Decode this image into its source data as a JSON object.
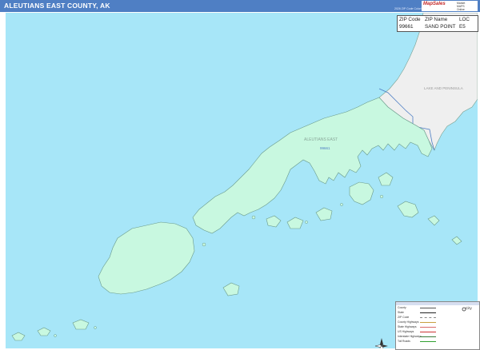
{
  "header": {
    "title": "ALEUTIANS EAST COUNTY, AK",
    "edition": "2026 ZIP Code Color/Cast Edition",
    "brand_logo": "MapSales",
    "brand_lines": [
      "Market",
      "MAPS",
      "Online"
    ]
  },
  "zip_table": {
    "columns": [
      "ZIP Code",
      "ZIP Name",
      "LOC"
    ],
    "rows": [
      {
        "zip": "99661",
        "name": "SAND POINT",
        "loc": "E5"
      }
    ]
  },
  "map": {
    "labels": {
      "county": "ALEUTIANS EAST",
      "zip": "99661",
      "neighbor": "LAKE AND PENINSULA"
    },
    "colors": {
      "water": "#a7e6f8",
      "land_zip": "#c8f8e0",
      "land_neighbor": "#efefef",
      "border": "#4f7fc4",
      "coast": "#6a9a8a"
    }
  },
  "legend": {
    "items": [
      {
        "label": "County",
        "desc": "",
        "color": "#555555"
      },
      {
        "label": "State",
        "desc": "",
        "color": "#222222"
      },
      {
        "label": "ZIP Code",
        "desc": "",
        "color": "#888888"
      },
      {
        "label": "County Highways",
        "desc": "",
        "color": "#c8a040"
      },
      {
        "label": "State Highways",
        "desc": "",
        "color": "#d86a6a"
      },
      {
        "label": "US Highways",
        "desc": "",
        "color": "#cc3333"
      },
      {
        "label": "Interstate Highways",
        "desc": "",
        "color": "#3a7a3a"
      },
      {
        "label": "Toll Roads",
        "desc": "",
        "color": "#30a030"
      }
    ],
    "city_label": "City"
  }
}
